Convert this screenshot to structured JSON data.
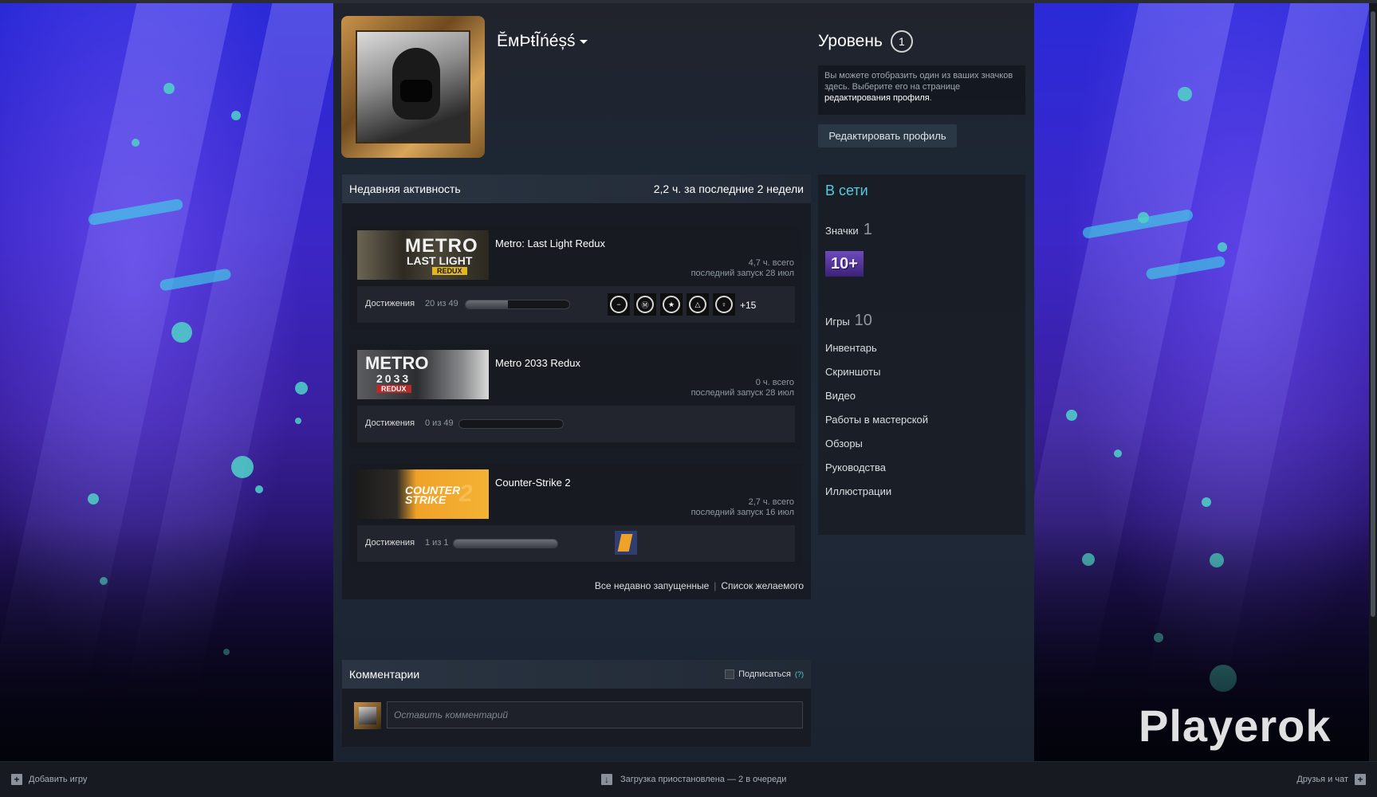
{
  "profile": {
    "username": "ĔмÞŧĨńéșś",
    "level_label": "Уровень",
    "level": "1",
    "badge_hint": "Вы можете отобразить один из ваших значков здесь. Выберите его на странице",
    "badge_hint_link": "редактирования профиля",
    "badge_hint_end": ".",
    "edit_button": "Редактировать профиль"
  },
  "activity": {
    "title": "Недавняя активность",
    "summary": "2,2 ч. за последние 2 недели",
    "ach_label": "Достижения",
    "games": [
      {
        "name": "Metro: Last Light Redux",
        "hours": "4,7 ч. всего",
        "last_played": "последний запуск 28 июл",
        "ach_count": "20 из 49",
        "ach_fraction": 0.41,
        "ach_more": "+15",
        "capsule_text": [
          "METRO",
          "LAST LIGHT",
          "REDUX"
        ]
      },
      {
        "name": "Metro 2033 Redux",
        "hours": "0 ч. всего",
        "last_played": "последний запуск 28 июл",
        "ach_count": "0 из 49",
        "ach_fraction": 0,
        "capsule_text": [
          "METRO",
          "2033",
          "REDUX"
        ]
      },
      {
        "name": "Counter-Strike 2",
        "hours": "2,7 ч. всего",
        "last_played": "последний запуск 16 июл",
        "ach_count": "1 из 1",
        "ach_fraction": 1,
        "capsule_text": [
          "COUNTER",
          "STRIKE",
          "2"
        ]
      }
    ],
    "link_recent": "Все недавно запущенные",
    "link_separator": "|",
    "link_wishlist": "Список желаемого"
  },
  "sidebar": {
    "online_title": "В сети",
    "badges_label": "Значки",
    "badges_count": "1",
    "badge_text": "10+",
    "games_label": "Игры",
    "games_count": "10",
    "links": [
      "Инвентарь",
      "Скриншоты",
      "Видео",
      "Работы в мастерской",
      "Обзоры",
      "Руководства",
      "Иллюстрации"
    ]
  },
  "comments": {
    "title": "Комментарии",
    "subscribe": "Подписаться",
    "help": "(?)",
    "placeholder": "Оставить комментарий"
  },
  "bottombar": {
    "add_game": "Добавить игру",
    "downloads": "Загрузка приостановлена — 2 в очереди",
    "friends": "Друзья и чат"
  },
  "watermark": "Playerok",
  "colors": {
    "accent_online": "#57cbde",
    "background": "#1b2230"
  }
}
